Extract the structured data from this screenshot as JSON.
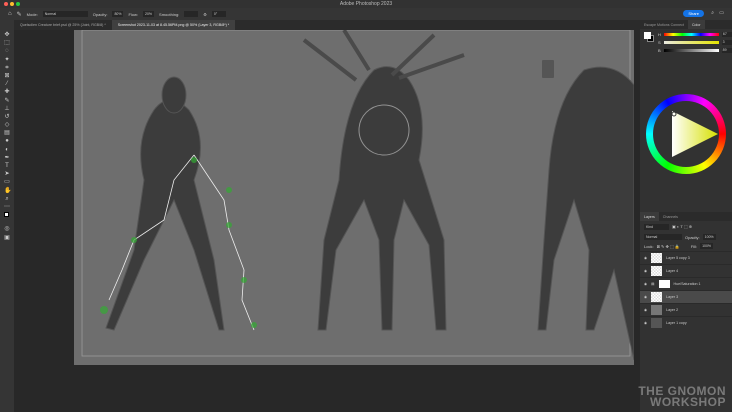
{
  "window": {
    "title": "Adobe Photoshop 2023"
  },
  "options": {
    "mode_label": "Mode:",
    "mode_value": "Normal",
    "opacity_label": "Opacity:",
    "opacity_value": "80%",
    "flow_label": "Flow:",
    "flow_value": "20%",
    "smoothing_label": "Smoothing:",
    "angle_value": "0°",
    "share_label": "Share"
  },
  "tabs": [
    {
      "label": "Quelsolien Creature brief.psd @ 25% (Joint, RGB/8) *"
    },
    {
      "label": "Screenshot 2023-11-03 at 8.45.56PM.png @ 50% (Layer 3, RGB/8*) *"
    }
  ],
  "color_panel": {
    "tabs": [
      "Escape Motions Connect",
      "Color"
    ],
    "h": "67",
    "s": "3",
    "b": "89",
    "unit": "%"
  },
  "layers_panel": {
    "tabs": [
      "Layers",
      "Channels"
    ],
    "filter": "Kind",
    "blend": "Normal",
    "opacity_label": "Opacity:",
    "opacity": "100%",
    "lock_label": "Lock:",
    "fill_label": "Fill:",
    "fill": "100%",
    "layers": [
      {
        "name": "Layer 5 copy 3"
      },
      {
        "name": "Layer 4"
      },
      {
        "name": "Hue/Saturation 1"
      },
      {
        "name": "Layer 3"
      },
      {
        "name": "Layer 2"
      },
      {
        "name": "Layer 1 copy"
      }
    ]
  },
  "watermark": {
    "line1": "THE GNOMON",
    "line2": "WORKSHOP"
  }
}
